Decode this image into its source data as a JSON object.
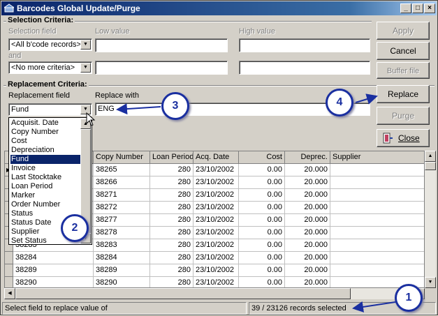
{
  "window": {
    "title": "Barcodes Global Update/Purge",
    "controls": [
      "_",
      "□",
      "×"
    ]
  },
  "selection": {
    "heading": "Selection Criteria:",
    "field_label": "Selection field",
    "low_label": "Low value",
    "high_label": "High value",
    "field1_value": "<All b'code records>",
    "and_label": "and",
    "field2_value": "<No more criteria>",
    "low1": "",
    "high1": "",
    "low2": "",
    "high2": ""
  },
  "buttons": {
    "apply": "Apply",
    "cancel": "Cancel",
    "buffer": "Buffer file",
    "replace": "Replace",
    "purge": "Purge",
    "close": "Close"
  },
  "replacement": {
    "heading": "Replacement Criteria:",
    "field_label": "Replacement field",
    "replace_label": "Replace with",
    "field_value": "Fund",
    "replace_value": "ENG"
  },
  "dropdown": {
    "items": [
      "Acquisit. Date",
      "Copy Number",
      "Cost",
      "Depreciation",
      "Fund",
      "Invoice",
      "Last Stocktake",
      "Loan Period",
      "Marker",
      "Order Number",
      "Status",
      "Status Date",
      "Supplier",
      "Set Status"
    ],
    "selected": "Fund"
  },
  "grid": {
    "columns": [
      "Copy Number",
      "Loan Period",
      "Acq. Date",
      "Cost",
      "Deprec.",
      "Supplier"
    ],
    "rows": [
      {
        "barcode": "38265",
        "copy": "38265",
        "loan": "280",
        "acq": "23/10/2002",
        "cost": "0.00",
        "dep": "20.000",
        "supplier": ""
      },
      {
        "barcode": "38266",
        "copy": "38266",
        "loan": "280",
        "acq": "23/10/2002",
        "cost": "0.00",
        "dep": "20.000",
        "supplier": ""
      },
      {
        "barcode": "38271",
        "copy": "38271",
        "loan": "280",
        "acq": "23/10/2002",
        "cost": "0.00",
        "dep": "20.000",
        "supplier": ""
      },
      {
        "barcode": "38272",
        "copy": "38272",
        "loan": "280",
        "acq": "23/10/2002",
        "cost": "0.00",
        "dep": "20.000",
        "supplier": ""
      },
      {
        "barcode": "38277",
        "copy": "38277",
        "loan": "280",
        "acq": "23/10/2002",
        "cost": "0.00",
        "dep": "20.000",
        "supplier": ""
      },
      {
        "barcode": "38278",
        "copy": "38278",
        "loan": "280",
        "acq": "23/10/2002",
        "cost": "0.00",
        "dep": "20.000",
        "supplier": ""
      },
      {
        "barcode": "38283",
        "copy": "38283",
        "loan": "280",
        "acq": "23/10/2002",
        "cost": "0.00",
        "dep": "20.000",
        "supplier": ""
      },
      {
        "barcode": "38284",
        "copy": "38284",
        "loan": "280",
        "acq": "23/10/2002",
        "cost": "0.00",
        "dep": "20.000",
        "supplier": ""
      },
      {
        "barcode": "38289",
        "copy": "38289",
        "loan": "280",
        "acq": "23/10/2002",
        "cost": "0.00",
        "dep": "20.000",
        "supplier": ""
      },
      {
        "barcode": "38290",
        "copy": "38290",
        "loan": "280",
        "acq": "23/10/2002",
        "cost": "0.00",
        "dep": "20.000",
        "supplier": ""
      }
    ]
  },
  "status": {
    "hint": "Select field to replace value of",
    "count": "39 / 23126 records selected"
  },
  "callouts": [
    "1",
    "2",
    "3",
    "4"
  ],
  "colors": {
    "face": "#d4d0c8",
    "title": "#0a246a",
    "callout": "#1a2fa0"
  }
}
